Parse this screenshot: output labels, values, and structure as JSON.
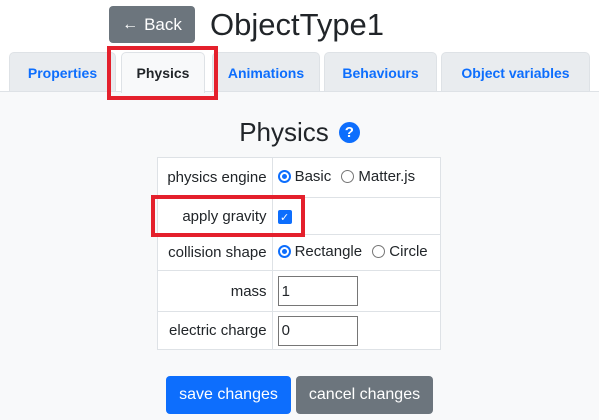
{
  "header": {
    "back_label": "Back",
    "title": "ObjectType1"
  },
  "tabs": [
    {
      "label": "Properties"
    },
    {
      "label": "Physics"
    },
    {
      "label": "Animations"
    },
    {
      "label": "Behaviours"
    },
    {
      "label": "Object variables"
    }
  ],
  "active_tab": "Physics",
  "section": {
    "title": "Physics",
    "help_glyph": "?"
  },
  "form": {
    "physics_engine": {
      "label": "physics engine",
      "options": [
        "Basic",
        "Matter.js"
      ],
      "selected": "Basic"
    },
    "apply_gravity": {
      "label": "apply gravity",
      "checked": true
    },
    "collision_shape": {
      "label": "collision shape",
      "options": [
        "Rectangle",
        "Circle"
      ],
      "selected": "Rectangle"
    },
    "mass": {
      "label": "mass",
      "value": "1"
    },
    "electric_charge": {
      "label": "electric charge",
      "value": "0"
    }
  },
  "buttons": {
    "save": "save changes",
    "cancel": "cancel changes"
  },
  "colors": {
    "primary": "#0d6efd",
    "secondary": "#6c757d",
    "highlight": "#e4202c"
  }
}
